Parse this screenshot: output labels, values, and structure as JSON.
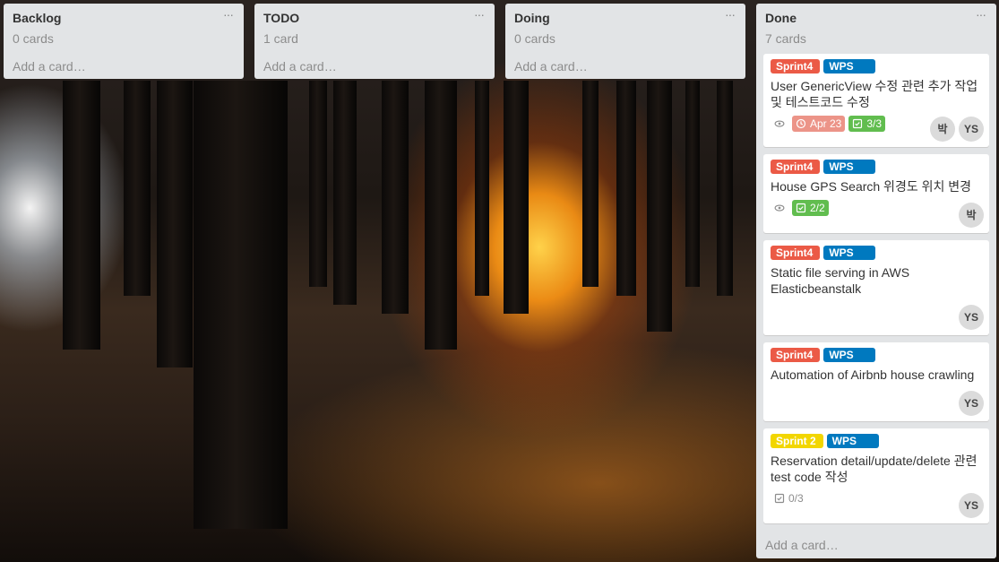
{
  "board": {
    "lists": [
      {
        "title": "Backlog",
        "count": "0 cards",
        "add": "Add a card…"
      },
      {
        "title": "TODO",
        "count": "1 card",
        "add": "Add a card…"
      },
      {
        "title": "Doing",
        "count": "0 cards",
        "add": "Add a card…"
      },
      {
        "title": "Done",
        "count": "7 cards",
        "add": "Add a card…",
        "cards": [
          {
            "labels": [
              "Sprint4",
              "WPS"
            ],
            "title": "User GenericView 수정 관련 추가 작업 및 테스트코드 수정",
            "due": "Apr 23",
            "checklist": "3/3",
            "members": [
              "박",
              "YS"
            ]
          },
          {
            "labels": [
              "Sprint4",
              "WPS"
            ],
            "title": "House GPS Search 위경도 위치 변경",
            "checklist": "2/2",
            "members": [
              "박"
            ]
          },
          {
            "labels": [
              "Sprint4",
              "WPS"
            ],
            "title": "Static file serving in AWS Elasticbeanstalk",
            "members": [
              "YS"
            ]
          },
          {
            "labels": [
              "Sprint4",
              "WPS"
            ],
            "title": "Automation of Airbnb house crawling",
            "members": [
              "YS"
            ]
          },
          {
            "labels": [
              "Sprint 2",
              "WPS"
            ],
            "title": "Reservation detail/update/delete 관련 test code 작성",
            "checklist": "0/3",
            "members": [
              "YS"
            ]
          }
        ]
      }
    ],
    "menu_glyph": "···"
  },
  "colors": {
    "red_label": "#eb5a46",
    "blue_label": "#0079bf",
    "yellow_label": "#f2d600",
    "checklist_done": "#61bd4f",
    "due_soon": "#ec9488",
    "list_bg": "#e2e4e6"
  },
  "icons": [
    "eye-icon",
    "clock-icon",
    "checklist-icon",
    "list-menu-icon"
  ]
}
